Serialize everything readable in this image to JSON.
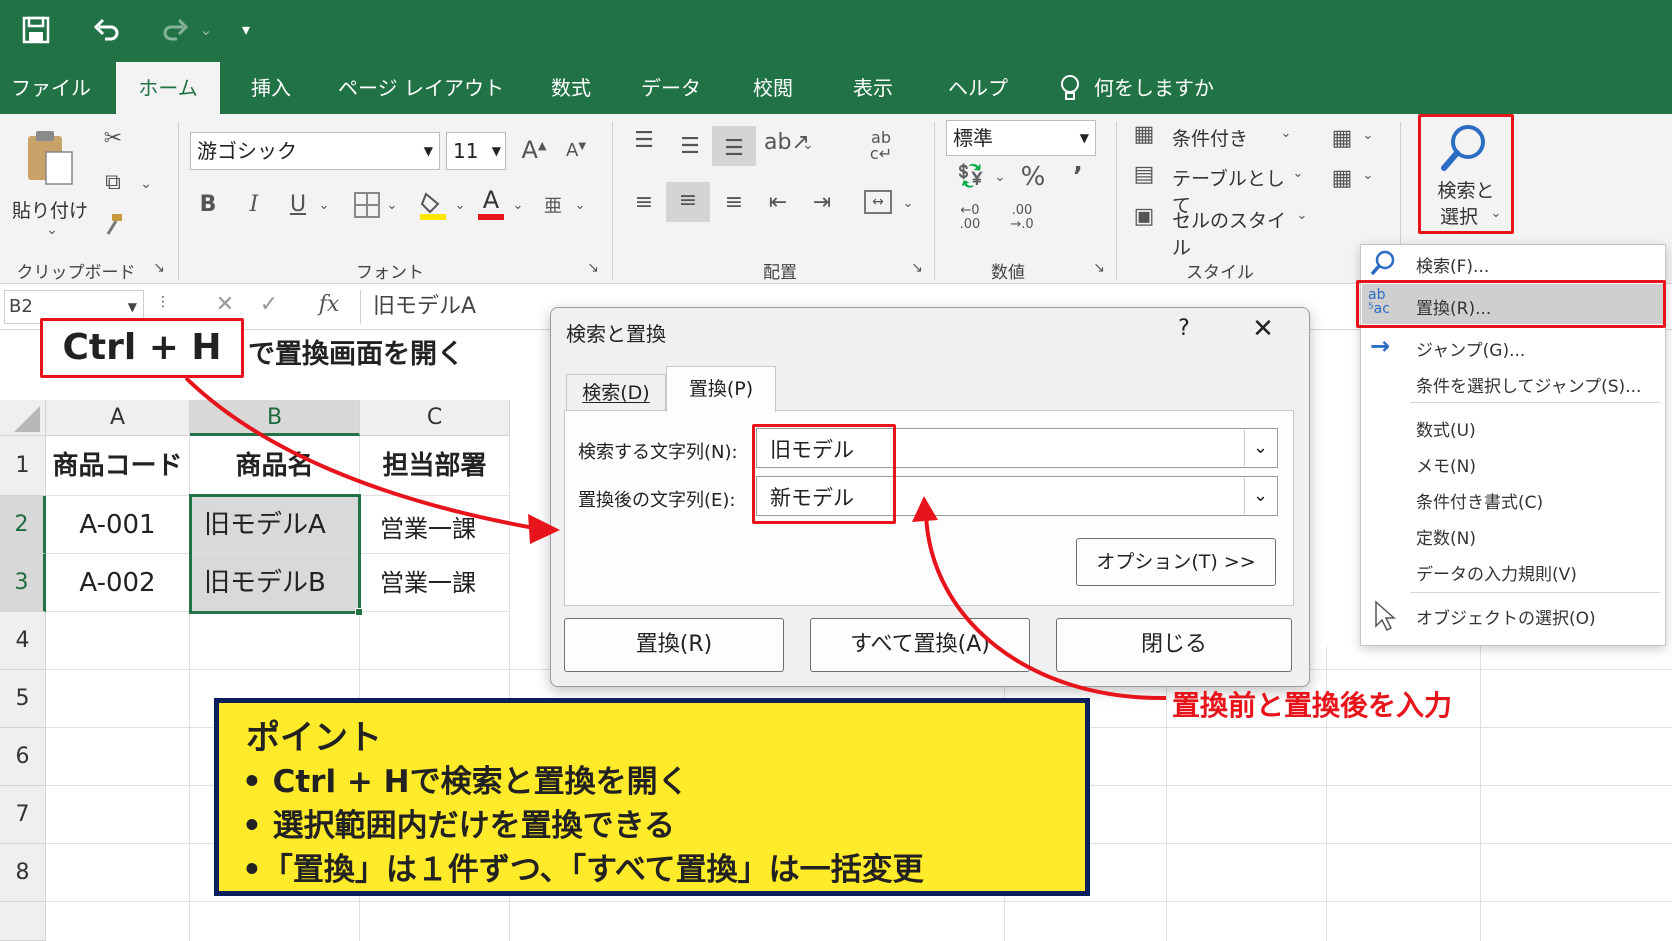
{
  "titlebar": {
    "redo_dropdown": "⌄",
    "customize": "▾"
  },
  "tabs": [
    "ファイル",
    "ホーム",
    "挿入",
    "ページ レイアウト",
    "数式",
    "データ",
    "校閲",
    "表示",
    "ヘルプ"
  ],
  "tell_me": "何をしますか",
  "ribbon": {
    "clipboard": {
      "paste": "貼り付け",
      "label": "クリップボード"
    },
    "font": {
      "name": "游ゴシック",
      "size": "11",
      "bold": "B",
      "italic": "I",
      "underline": "U",
      "label": "フォント"
    },
    "alignment": {
      "label": "配置"
    },
    "number": {
      "format": "標準",
      "percent": "%",
      "comma": "’",
      "inc": ".00\n→.0",
      "label": "数値"
    },
    "styles": {
      "conditional": "条件付き",
      "table": "テーブルとして",
      "cell": "セルのスタイル",
      "label": "スタイル"
    },
    "find_select": {
      "label1": "検索と",
      "label2": "選択"
    }
  },
  "formula_bar": {
    "name_box": "B2",
    "fx": "fx",
    "content": "旧モデルA"
  },
  "sheet": {
    "columns": [
      "A",
      "B",
      "C"
    ],
    "rows": [
      "1",
      "2",
      "3",
      "4",
      "5",
      "6",
      "7",
      "8"
    ],
    "cells": [
      [
        "商品コード",
        "商品名",
        "担当部署"
      ],
      [
        "A-001",
        "旧モデルA",
        "営業一課"
      ],
      [
        "A-002",
        "旧モデルB",
        "営業一課"
      ]
    ]
  },
  "dialog": {
    "title": "検索と置換",
    "help": "?",
    "close": "✕",
    "tab_find": "検索(D)",
    "tab_replace": "置換(P)",
    "find_label": "検索する文字列(N):",
    "find_value": "旧モデル",
    "replace_label": "置換後の文字列(E):",
    "replace_value": "新モデル",
    "options_button": "オプション(T) >>",
    "replace_button": "置換(R)",
    "replace_all_button": "すべて置換(A)",
    "close_button": "閉じる"
  },
  "menu": {
    "items": [
      "検索(F)...",
      "置換(R)...",
      "ジャンプ(G)...",
      "条件を選択してジャンプ(S)...",
      "数式(U)",
      "メモ(N)",
      "条件付き書式(C)",
      "定数(N)",
      "データの入力規則(V)",
      "オブジェクトの選択(O)"
    ]
  },
  "annotations": {
    "shortcut": "Ctrl + H",
    "shortcut_desc": "で置換画面を開く",
    "input_note": "置換前と置換後を入力",
    "point_title": "ポイント",
    "points": [
      "• Ctrl + Hで検索と置換を開く",
      "• 選択範囲内だけを置換できる",
      "•「置換」は１件ずつ、「すべて置換」は一括変更"
    ]
  },
  "colors": {
    "excel_green": "#217346",
    "red": "#e8141b",
    "yellow": "#ffeb2a"
  }
}
